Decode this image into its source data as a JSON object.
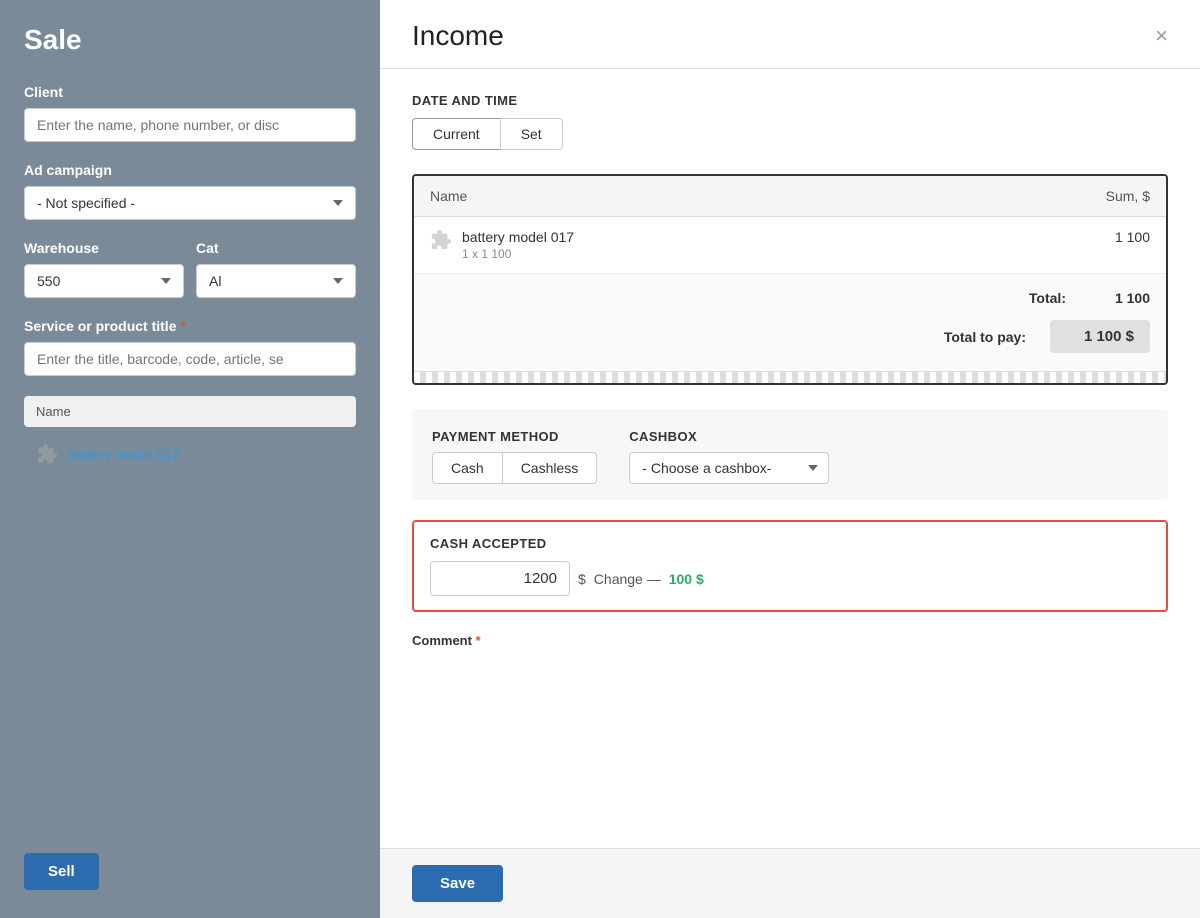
{
  "leftPanel": {
    "title": "Sale",
    "client": {
      "label": "Client",
      "placeholder": "Enter the name, phone number, or disc"
    },
    "adCampaign": {
      "label": "Ad campaign",
      "value": "- Not specified -"
    },
    "warehouse": {
      "label": "Warehouse",
      "value": "550"
    },
    "category": {
      "label": "Cat",
      "value": "Al"
    },
    "serviceOrProduct": {
      "label": "Service or product title",
      "required": true,
      "placeholder": "Enter the title, barcode, code, article, se"
    },
    "tableHeaders": {
      "name": "Name"
    },
    "tableRows": [
      {
        "name": "battery model 017"
      }
    ],
    "sellButton": "Sell"
  },
  "modal": {
    "title": "Income",
    "closeLabel": "×",
    "dateTime": {
      "sectionLabel": "Date and time",
      "currentBtn": "Current",
      "setBtn": "Set"
    },
    "receiptTable": {
      "headers": {
        "name": "Name",
        "sum": "Sum, $"
      },
      "rows": [
        {
          "name": "battery model 017",
          "sub": "1 x 1 100",
          "price": "1 100"
        }
      ],
      "total": {
        "label": "Total:",
        "value": "1 100"
      },
      "totalToPay": {
        "label": "Total to pay:",
        "value": "1 100 $"
      }
    },
    "payment": {
      "methodLabel": "Payment method",
      "cashBtn": "Cash",
      "cashlessBtn": "Cashless",
      "cashboxLabel": "Cashbox",
      "cashboxPlaceholder": "- Choose a cashbox-"
    },
    "cashAccepted": {
      "label": "Cash accepted",
      "value": "1200",
      "currencySign": "$",
      "changeLabel": "Change —",
      "changeAmount": "100 $"
    },
    "comment": {
      "label": "Comment",
      "required": true
    },
    "footer": {
      "saveBtn": "Save"
    }
  }
}
